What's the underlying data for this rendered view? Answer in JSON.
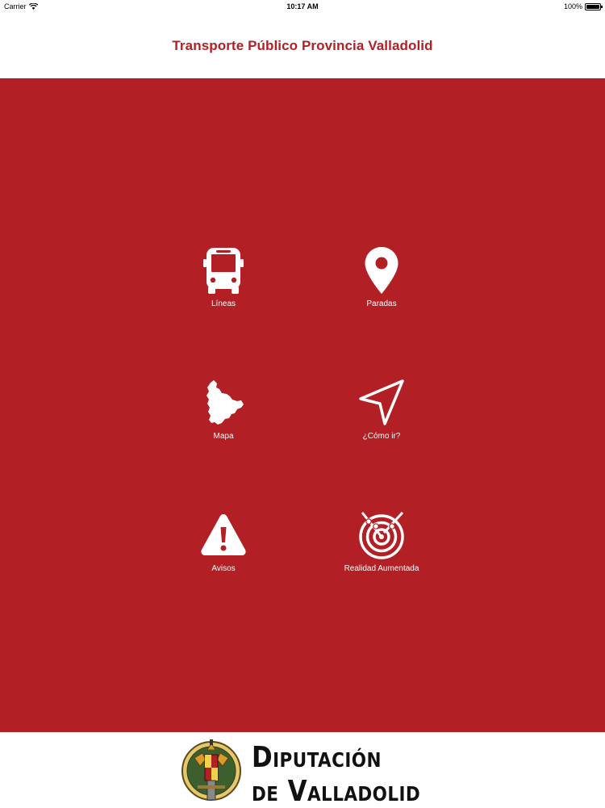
{
  "status_bar": {
    "carrier": "Carrier",
    "time": "10:17 AM",
    "battery": "100%"
  },
  "header": {
    "title": "Transporte Público Provincia Valladolid"
  },
  "colors": {
    "brand_red": "#b21f24",
    "white": "#ffffff"
  },
  "menu": {
    "items": [
      {
        "label": "Líneas",
        "icon": "bus-icon"
      },
      {
        "label": "Paradas",
        "icon": "map-pin-icon"
      },
      {
        "label": "Mapa",
        "icon": "province-map-icon"
      },
      {
        "label": "¿Cómo ir?",
        "icon": "navigation-arrow-icon"
      },
      {
        "label": "Avisos",
        "icon": "warning-icon"
      },
      {
        "label": "Realidad Aumentada",
        "icon": "radar-icon"
      }
    ]
  },
  "footer": {
    "brand_line1": "Diputación",
    "brand_line2": "de Valladolid"
  }
}
